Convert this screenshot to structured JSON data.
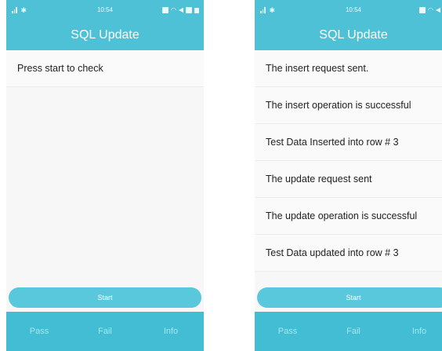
{
  "screens": [
    {
      "status_bar": {
        "time": "10:54"
      },
      "app_bar": {
        "title": "SQL Update"
      },
      "messages": [
        "Press start to check"
      ],
      "start_button": {
        "label": "Start"
      },
      "bottom_tabs": [
        {
          "label": "Pass"
        },
        {
          "label": "Fail"
        },
        {
          "label": "Info"
        }
      ]
    },
    {
      "status_bar": {
        "time": "10:54"
      },
      "app_bar": {
        "title": "SQL Update"
      },
      "messages": [
        "The insert request sent.",
        "The insert operation is successful",
        "Test Data Inserted into row # 3",
        "The update request sent",
        "The update operation is successful",
        "Test Data updated into row # 3"
      ],
      "start_button": {
        "label": "Start"
      },
      "bottom_tabs": [
        {
          "label": "Pass"
        },
        {
          "label": "Fail"
        },
        {
          "label": "Info"
        }
      ]
    }
  ],
  "colors": {
    "primary": "#4fc1d6",
    "button": "#5ac8dc",
    "bottom_bar": "#43bdd3",
    "tab_text": "#a6e6f1"
  },
  "icons": [
    "signal-icon",
    "bluetooth-icon",
    "nfc-icon",
    "wifi-icon",
    "notification-icon",
    "battery-icon"
  ]
}
